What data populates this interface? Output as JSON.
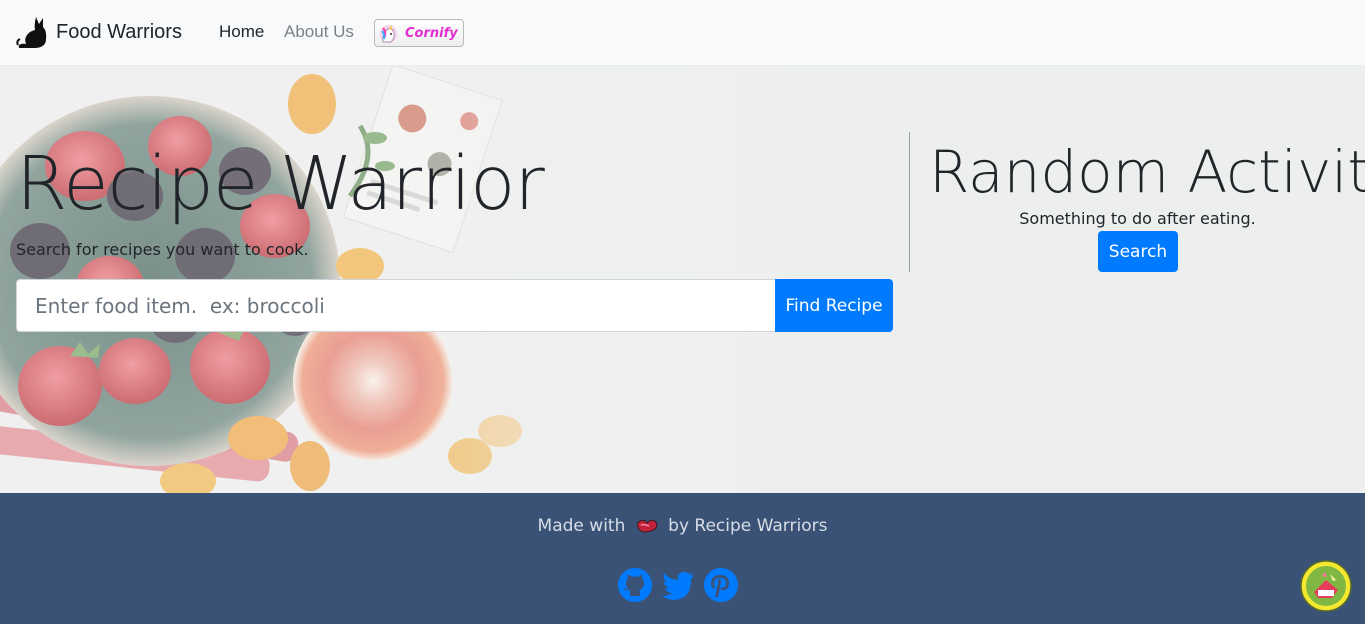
{
  "navbar": {
    "brand": "Food Warriors",
    "brand_icon": "ninja-cat-logo-icon",
    "links": [
      "Home",
      "About Us"
    ],
    "cornify_label": "Cornify"
  },
  "hero": {
    "title": "Recipe Warrior",
    "subtitle": "Search for recipes you want to cook.",
    "search_placeholder": "Enter food item.  ex: broccoli",
    "search_value": "",
    "search_button": "Find Recipe",
    "activity": {
      "title": "Random Activity",
      "subtitle": "Something to do after eating.",
      "button": "Search"
    }
  },
  "footer": {
    "made_with": "Made with",
    "by": "by Recipe Warriors",
    "icons": [
      "heart-icon",
      "github-icon",
      "twitter-icon",
      "pinterest-icon"
    ]
  },
  "colors": {
    "primary": "#007bff",
    "footer_bg": "#3b5277",
    "navbar_bg": "#f8f9fa",
    "cornify": "#e12fd4"
  }
}
